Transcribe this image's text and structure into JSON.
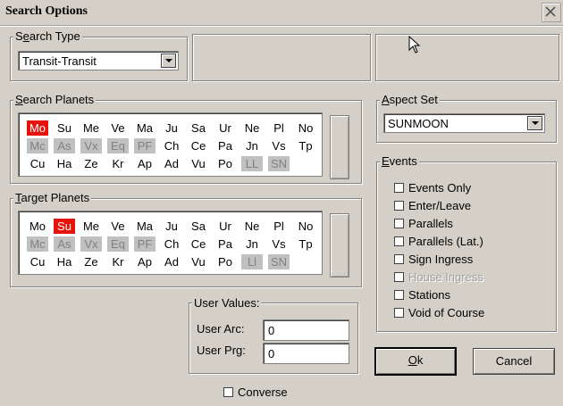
{
  "window": {
    "title": "Search Options"
  },
  "search_type": {
    "label": "Search Type",
    "accel": "e",
    "selected": "Transit-Transit"
  },
  "search_planets": {
    "label": "Search Planets",
    "accel": "S",
    "rows": [
      [
        {
          "t": "Mo",
          "s": "sel"
        },
        {
          "t": "Su"
        },
        {
          "t": "Me"
        },
        {
          "t": "Ve"
        },
        {
          "t": "Ma"
        },
        {
          "t": "Ju"
        },
        {
          "t": "Sa"
        },
        {
          "t": "Ur"
        },
        {
          "t": "Ne"
        },
        {
          "t": "Pl"
        },
        {
          "t": "No"
        }
      ],
      [
        {
          "t": "Mc",
          "s": "dis"
        },
        {
          "t": "As",
          "s": "dis"
        },
        {
          "t": "Vx",
          "s": "dis"
        },
        {
          "t": "Eq",
          "s": "dis"
        },
        {
          "t": "PF",
          "s": "dis"
        },
        {
          "t": "Ch"
        },
        {
          "t": "Ce"
        },
        {
          "t": "Pa"
        },
        {
          "t": "Jn"
        },
        {
          "t": "Vs"
        },
        {
          "t": "Tp"
        }
      ],
      [
        {
          "t": "Cu"
        },
        {
          "t": "Ha"
        },
        {
          "t": "Ze"
        },
        {
          "t": "Kr"
        },
        {
          "t": "Ap"
        },
        {
          "t": "Ad"
        },
        {
          "t": "Vu"
        },
        {
          "t": "Po"
        },
        {
          "t": "LL",
          "s": "dis"
        },
        {
          "t": "SN",
          "s": "dis"
        }
      ]
    ]
  },
  "target_planets": {
    "label": "Target Planets",
    "accel": "T",
    "rows": [
      [
        {
          "t": "Mo"
        },
        {
          "t": "Su",
          "s": "sel"
        },
        {
          "t": "Me"
        },
        {
          "t": "Ve"
        },
        {
          "t": "Ma"
        },
        {
          "t": "Ju"
        },
        {
          "t": "Sa"
        },
        {
          "t": "Ur"
        },
        {
          "t": "Ne"
        },
        {
          "t": "Pl"
        },
        {
          "t": "No"
        }
      ],
      [
        {
          "t": "Mc",
          "s": "dis"
        },
        {
          "t": "As",
          "s": "dis"
        },
        {
          "t": "Vx",
          "s": "dis"
        },
        {
          "t": "Eq",
          "s": "dis"
        },
        {
          "t": "PF",
          "s": "dis"
        },
        {
          "t": "Ch"
        },
        {
          "t": "Ce"
        },
        {
          "t": "Pa"
        },
        {
          "t": "Jn"
        },
        {
          "t": "Vs"
        },
        {
          "t": "Tp"
        }
      ],
      [
        {
          "t": "Cu"
        },
        {
          "t": "Ha"
        },
        {
          "t": "Ze"
        },
        {
          "t": "Kr"
        },
        {
          "t": "Ap"
        },
        {
          "t": "Ad"
        },
        {
          "t": "Vu"
        },
        {
          "t": "Po"
        },
        {
          "t": "Ll",
          "s": "dis"
        },
        {
          "t": "SN",
          "s": "dis"
        }
      ]
    ]
  },
  "aspect_set": {
    "label": "Aspect Set",
    "accel": "A",
    "selected": "SUNMOON"
  },
  "events": {
    "label": "Events",
    "accel": "E",
    "items": [
      {
        "label": "Events Only",
        "checked": false,
        "enabled": true
      },
      {
        "label": "Enter/Leave",
        "checked": false,
        "enabled": true
      },
      {
        "label": "Parallels",
        "checked": false,
        "enabled": true
      },
      {
        "label": "Parallels (Lat.)",
        "checked": false,
        "enabled": true
      },
      {
        "label": "Sign Ingress",
        "checked": false,
        "enabled": true
      },
      {
        "label": "House Ingress",
        "checked": false,
        "enabled": false
      },
      {
        "label": "Stations",
        "checked": false,
        "enabled": true
      },
      {
        "label": "Void of Course",
        "checked": false,
        "enabled": true
      }
    ]
  },
  "user_values": {
    "label": "User Values:",
    "arc_label": "User Arc:",
    "arc_value": "0",
    "prg_label": "User Prg:",
    "prg_value": "0"
  },
  "converse": {
    "label": "Converse",
    "checked": false
  },
  "buttons": {
    "ok": "Ok",
    "ok_accel": "O",
    "cancel": "Cancel"
  },
  "colors": {
    "selected": "#e8120d",
    "disabled": "#c0c0c0",
    "face": "#d4d0c8"
  }
}
